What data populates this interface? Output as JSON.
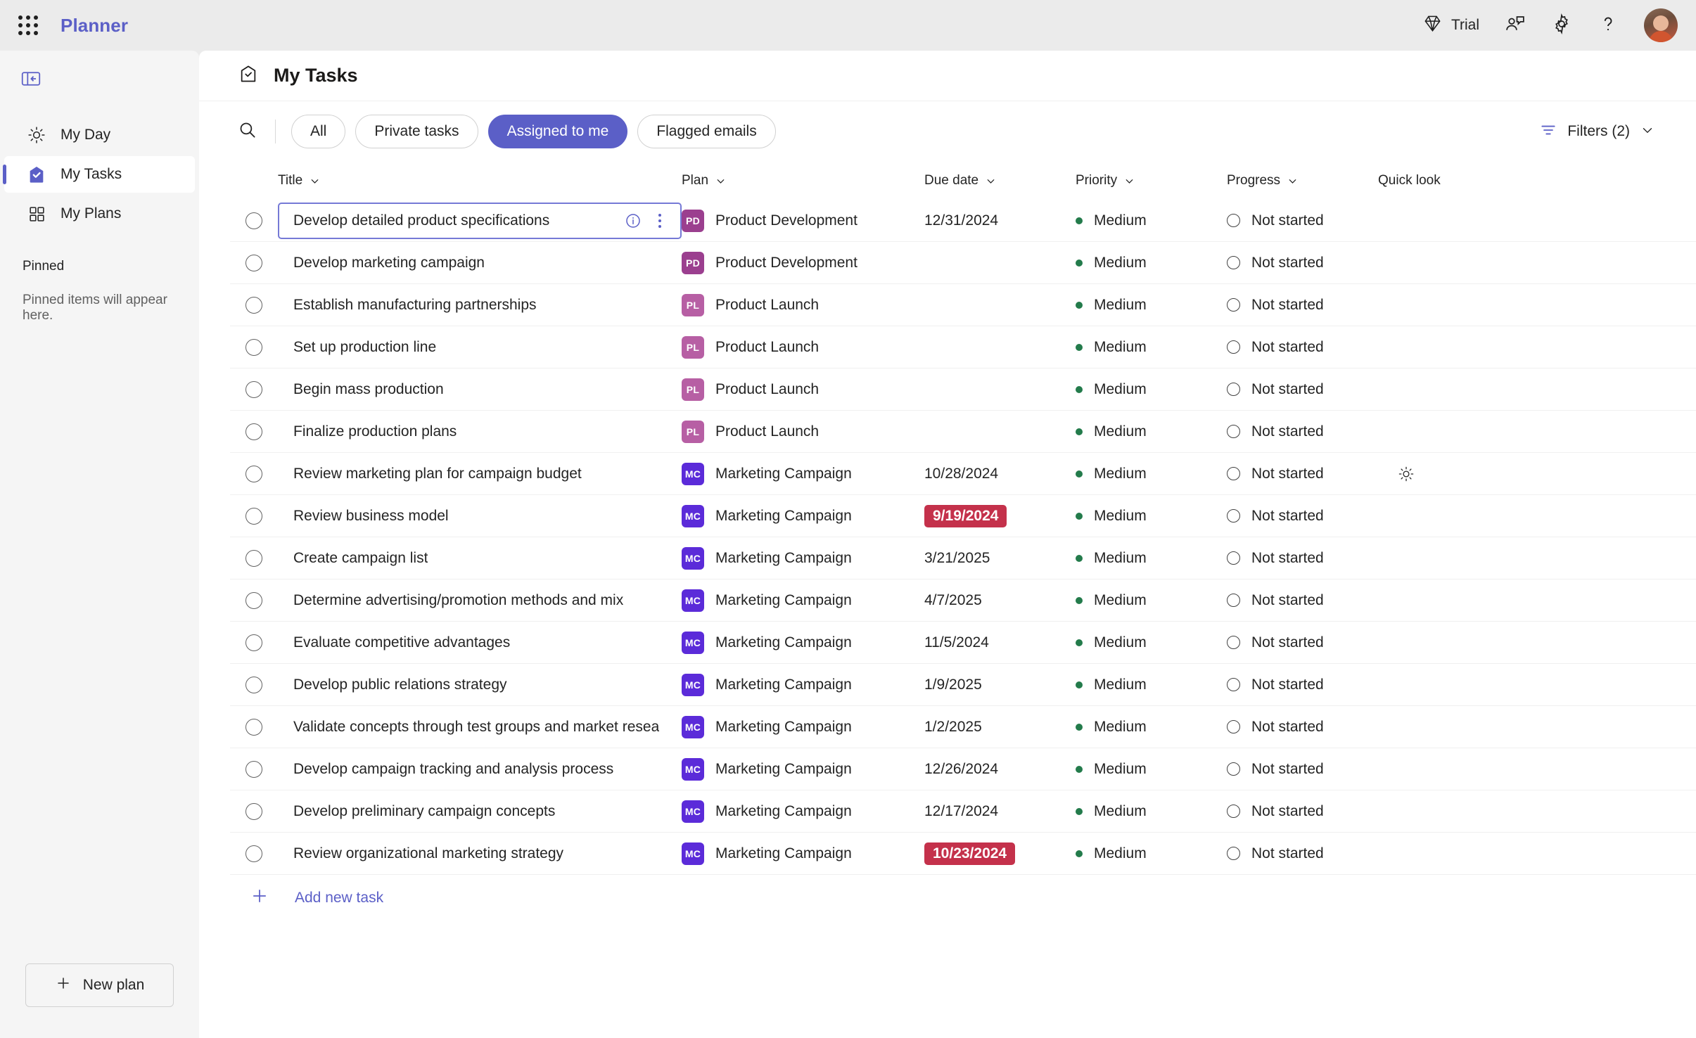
{
  "topbar": {
    "app_name": "Planner",
    "waffle_icon": "app-launcher-icon",
    "trial_label": "Trial",
    "trial_icon": "diamond-icon",
    "feedback_icon": "feedback-person-icon",
    "settings_icon": "gear-icon",
    "help_icon": "question-mark-icon",
    "avatar_icon": "user-avatar",
    "brand_color": "#5b5fc7"
  },
  "sidebar": {
    "collapse_icon": "panel-collapse-icon",
    "items": [
      {
        "label": "My Day",
        "icon": "sun-icon",
        "active": false
      },
      {
        "label": "My Tasks",
        "icon": "tasks-home-check-icon",
        "active": true
      },
      {
        "label": "My Plans",
        "icon": "grid-squares-icon",
        "active": false
      }
    ],
    "pinned_header": "Pinned",
    "pinned_empty": "Pinned items will appear here.",
    "new_plan_label": "New plan",
    "new_plan_icon": "plus-icon"
  },
  "page": {
    "title": "My Tasks",
    "title_icon": "tasks-home-check-icon"
  },
  "toolbar": {
    "search_icon": "search-icon",
    "pills": [
      {
        "label": "All",
        "active": false
      },
      {
        "label": "Private tasks",
        "active": false
      },
      {
        "label": "Assigned to me",
        "active": true
      },
      {
        "label": "Flagged emails",
        "active": false
      }
    ],
    "filters_label": "Filters (2)",
    "filters_icon": "filter-icon",
    "filters_chevron": "chevron-down-icon",
    "accent_color": "#5b5fc7"
  },
  "table": {
    "columns": [
      {
        "label": "Title",
        "sortable": true
      },
      {
        "label": "Plan",
        "sortable": true
      },
      {
        "label": "Due date",
        "sortable": true
      },
      {
        "label": "Priority",
        "sortable": true
      },
      {
        "label": "Progress",
        "sortable": true
      },
      {
        "label": "Quick look",
        "sortable": false
      }
    ],
    "plan_colors": {
      "PD": "#9b3f8f",
      "PL": "#b75fa4",
      "MC": "#5b2bd9"
    },
    "overdue_color": "#c4314b",
    "priority_dot_color": "#237b4b",
    "rows": [
      {
        "title": "Develop detailed product specifications",
        "plan_initials": "PD",
        "plan": "Product Development",
        "due": "12/31/2024",
        "overdue": false,
        "priority": "Medium",
        "progress": "Not started",
        "editing": true,
        "quicklook": false
      },
      {
        "title": "Develop marketing campaign",
        "plan_initials": "PD",
        "plan": "Product Development",
        "due": "",
        "overdue": false,
        "priority": "Medium",
        "progress": "Not started",
        "editing": false,
        "quicklook": false
      },
      {
        "title": "Establish manufacturing partnerships",
        "plan_initials": "PL",
        "plan": "Product Launch",
        "due": "",
        "overdue": false,
        "priority": "Medium",
        "progress": "Not started",
        "editing": false,
        "quicklook": false
      },
      {
        "title": "Set up production line",
        "plan_initials": "PL",
        "plan": "Product Launch",
        "due": "",
        "overdue": false,
        "priority": "Medium",
        "progress": "Not started",
        "editing": false,
        "quicklook": false
      },
      {
        "title": "Begin mass production",
        "plan_initials": "PL",
        "plan": "Product Launch",
        "due": "",
        "overdue": false,
        "priority": "Medium",
        "progress": "Not started",
        "editing": false,
        "quicklook": false
      },
      {
        "title": "Finalize production plans",
        "plan_initials": "PL",
        "plan": "Product Launch",
        "due": "",
        "overdue": false,
        "priority": "Medium",
        "progress": "Not started",
        "editing": false,
        "quicklook": false
      },
      {
        "title": "Review marketing plan for campaign budget",
        "plan_initials": "MC",
        "plan": "Marketing Campaign",
        "due": "10/28/2024",
        "overdue": false,
        "priority": "Medium",
        "progress": "Not started",
        "editing": false,
        "quicklook": true
      },
      {
        "title": "Review business model",
        "plan_initials": "MC",
        "plan": "Marketing Campaign",
        "due": "9/19/2024",
        "overdue": true,
        "priority": "Medium",
        "progress": "Not started",
        "editing": false,
        "quicklook": false
      },
      {
        "title": "Create campaign list",
        "plan_initials": "MC",
        "plan": "Marketing Campaign",
        "due": "3/21/2025",
        "overdue": false,
        "priority": "Medium",
        "progress": "Not started",
        "editing": false,
        "quicklook": false
      },
      {
        "title": "Determine advertising/promotion methods and mix",
        "plan_initials": "MC",
        "plan": "Marketing Campaign",
        "due": "4/7/2025",
        "overdue": false,
        "priority": "Medium",
        "progress": "Not started",
        "editing": false,
        "quicklook": false
      },
      {
        "title": "Evaluate competitive advantages",
        "plan_initials": "MC",
        "plan": "Marketing Campaign",
        "due": "11/5/2024",
        "overdue": false,
        "priority": "Medium",
        "progress": "Not started",
        "editing": false,
        "quicklook": false
      },
      {
        "title": "Develop public relations strategy",
        "plan_initials": "MC",
        "plan": "Marketing Campaign",
        "due": "1/9/2025",
        "overdue": false,
        "priority": "Medium",
        "progress": "Not started",
        "editing": false,
        "quicklook": false
      },
      {
        "title": "Validate concepts through test groups and market resea",
        "plan_initials": "MC",
        "plan": "Marketing Campaign",
        "due": "1/2/2025",
        "overdue": false,
        "priority": "Medium",
        "progress": "Not started",
        "editing": false,
        "quicklook": false
      },
      {
        "title": "Develop campaign tracking and analysis process",
        "plan_initials": "MC",
        "plan": "Marketing Campaign",
        "due": "12/26/2024",
        "overdue": false,
        "priority": "Medium",
        "progress": "Not started",
        "editing": false,
        "quicklook": false
      },
      {
        "title": "Develop preliminary campaign concepts",
        "plan_initials": "MC",
        "plan": "Marketing Campaign",
        "due": "12/17/2024",
        "overdue": false,
        "priority": "Medium",
        "progress": "Not started",
        "editing": false,
        "quicklook": false
      },
      {
        "title": "Review organizational marketing strategy",
        "plan_initials": "MC",
        "plan": "Marketing Campaign",
        "due": "10/23/2024",
        "overdue": true,
        "priority": "Medium",
        "progress": "Not started",
        "editing": false,
        "quicklook": false
      }
    ],
    "add_task_label": "Add new task",
    "add_task_icon": "plus-icon"
  }
}
